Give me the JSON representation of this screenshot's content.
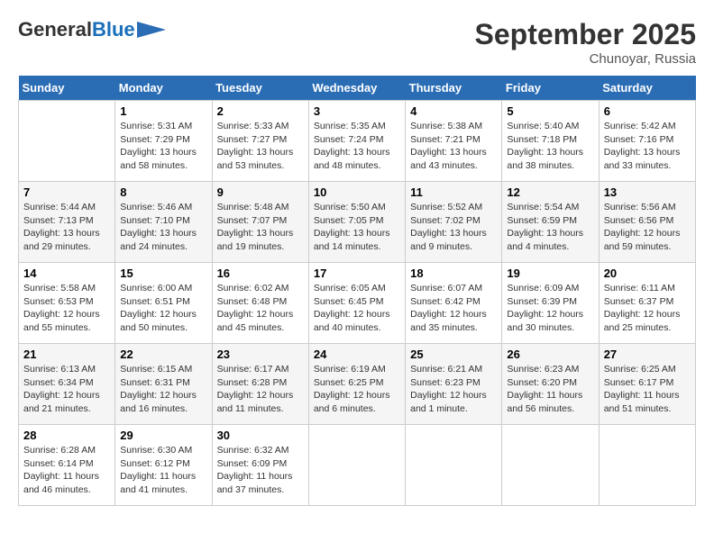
{
  "header": {
    "logo_general": "General",
    "logo_blue": "Blue",
    "month_title": "September 2025",
    "location": "Chunoyar, Russia"
  },
  "days_of_week": [
    "Sunday",
    "Monday",
    "Tuesday",
    "Wednesday",
    "Thursday",
    "Friday",
    "Saturday"
  ],
  "weeks": [
    [
      {
        "day": "",
        "info": ""
      },
      {
        "day": "1",
        "info": "Sunrise: 5:31 AM\nSunset: 7:29 PM\nDaylight: 13 hours\nand 58 minutes."
      },
      {
        "day": "2",
        "info": "Sunrise: 5:33 AM\nSunset: 7:27 PM\nDaylight: 13 hours\nand 53 minutes."
      },
      {
        "day": "3",
        "info": "Sunrise: 5:35 AM\nSunset: 7:24 PM\nDaylight: 13 hours\nand 48 minutes."
      },
      {
        "day": "4",
        "info": "Sunrise: 5:38 AM\nSunset: 7:21 PM\nDaylight: 13 hours\nand 43 minutes."
      },
      {
        "day": "5",
        "info": "Sunrise: 5:40 AM\nSunset: 7:18 PM\nDaylight: 13 hours\nand 38 minutes."
      },
      {
        "day": "6",
        "info": "Sunrise: 5:42 AM\nSunset: 7:16 PM\nDaylight: 13 hours\nand 33 minutes."
      }
    ],
    [
      {
        "day": "7",
        "info": "Sunrise: 5:44 AM\nSunset: 7:13 PM\nDaylight: 13 hours\nand 29 minutes."
      },
      {
        "day": "8",
        "info": "Sunrise: 5:46 AM\nSunset: 7:10 PM\nDaylight: 13 hours\nand 24 minutes."
      },
      {
        "day": "9",
        "info": "Sunrise: 5:48 AM\nSunset: 7:07 PM\nDaylight: 13 hours\nand 19 minutes."
      },
      {
        "day": "10",
        "info": "Sunrise: 5:50 AM\nSunset: 7:05 PM\nDaylight: 13 hours\nand 14 minutes."
      },
      {
        "day": "11",
        "info": "Sunrise: 5:52 AM\nSunset: 7:02 PM\nDaylight: 13 hours\nand 9 minutes."
      },
      {
        "day": "12",
        "info": "Sunrise: 5:54 AM\nSunset: 6:59 PM\nDaylight: 13 hours\nand 4 minutes."
      },
      {
        "day": "13",
        "info": "Sunrise: 5:56 AM\nSunset: 6:56 PM\nDaylight: 12 hours\nand 59 minutes."
      }
    ],
    [
      {
        "day": "14",
        "info": "Sunrise: 5:58 AM\nSunset: 6:53 PM\nDaylight: 12 hours\nand 55 minutes."
      },
      {
        "day": "15",
        "info": "Sunrise: 6:00 AM\nSunset: 6:51 PM\nDaylight: 12 hours\nand 50 minutes."
      },
      {
        "day": "16",
        "info": "Sunrise: 6:02 AM\nSunset: 6:48 PM\nDaylight: 12 hours\nand 45 minutes."
      },
      {
        "day": "17",
        "info": "Sunrise: 6:05 AM\nSunset: 6:45 PM\nDaylight: 12 hours\nand 40 minutes."
      },
      {
        "day": "18",
        "info": "Sunrise: 6:07 AM\nSunset: 6:42 PM\nDaylight: 12 hours\nand 35 minutes."
      },
      {
        "day": "19",
        "info": "Sunrise: 6:09 AM\nSunset: 6:39 PM\nDaylight: 12 hours\nand 30 minutes."
      },
      {
        "day": "20",
        "info": "Sunrise: 6:11 AM\nSunset: 6:37 PM\nDaylight: 12 hours\nand 25 minutes."
      }
    ],
    [
      {
        "day": "21",
        "info": "Sunrise: 6:13 AM\nSunset: 6:34 PM\nDaylight: 12 hours\nand 21 minutes."
      },
      {
        "day": "22",
        "info": "Sunrise: 6:15 AM\nSunset: 6:31 PM\nDaylight: 12 hours\nand 16 minutes."
      },
      {
        "day": "23",
        "info": "Sunrise: 6:17 AM\nSunset: 6:28 PM\nDaylight: 12 hours\nand 11 minutes."
      },
      {
        "day": "24",
        "info": "Sunrise: 6:19 AM\nSunset: 6:25 PM\nDaylight: 12 hours\nand 6 minutes."
      },
      {
        "day": "25",
        "info": "Sunrise: 6:21 AM\nSunset: 6:23 PM\nDaylight: 12 hours\nand 1 minute."
      },
      {
        "day": "26",
        "info": "Sunrise: 6:23 AM\nSunset: 6:20 PM\nDaylight: 11 hours\nand 56 minutes."
      },
      {
        "day": "27",
        "info": "Sunrise: 6:25 AM\nSunset: 6:17 PM\nDaylight: 11 hours\nand 51 minutes."
      }
    ],
    [
      {
        "day": "28",
        "info": "Sunrise: 6:28 AM\nSunset: 6:14 PM\nDaylight: 11 hours\nand 46 minutes."
      },
      {
        "day": "29",
        "info": "Sunrise: 6:30 AM\nSunset: 6:12 PM\nDaylight: 11 hours\nand 41 minutes."
      },
      {
        "day": "30",
        "info": "Sunrise: 6:32 AM\nSunset: 6:09 PM\nDaylight: 11 hours\nand 37 minutes."
      },
      {
        "day": "",
        "info": ""
      },
      {
        "day": "",
        "info": ""
      },
      {
        "day": "",
        "info": ""
      },
      {
        "day": "",
        "info": ""
      }
    ]
  ]
}
